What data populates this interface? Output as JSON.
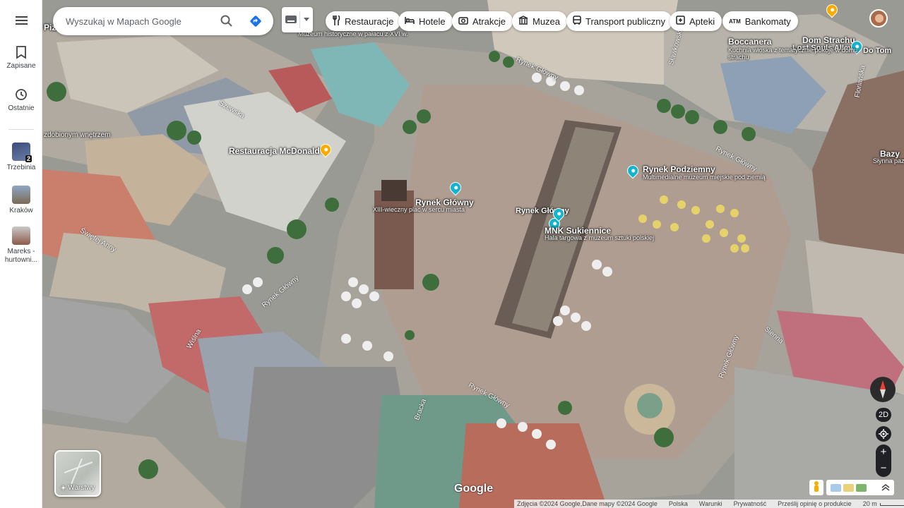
{
  "app": {
    "accent": "#1a73e8"
  },
  "rail": {
    "items": [
      {
        "label": "Zapisane",
        "icon": "bookmark-icon"
      },
      {
        "label": "Ostatnie",
        "icon": "history-icon"
      }
    ],
    "recents": [
      {
        "label": "Trzebinia",
        "badge": "2"
      },
      {
        "label": "Kraków",
        "badge": ""
      },
      {
        "label": "Mareks - hurtowni..."
      }
    ]
  },
  "search": {
    "placeholder": "Wyszukaj w Mapach Google"
  },
  "chips": [
    {
      "label": "Restauracje",
      "icon": "fork-knife-icon"
    },
    {
      "label": "Hotele",
      "icon": "bed-icon"
    },
    {
      "label": "Atrakcje",
      "icon": "camera-icon"
    },
    {
      "label": "Muzea",
      "icon": "museum-icon"
    },
    {
      "label": "Transport publiczny",
      "icon": "bus-icon"
    },
    {
      "label": "Apteki",
      "icon": "pharmacy-icon"
    },
    {
      "label": "Bankomaty",
      "icon": "atm-icon"
    }
  ],
  "map": {
    "pois": [
      {
        "name": "Restauracja McDonald's",
        "color": "#f9ab00"
      },
      {
        "name": "Rynek Główny",
        "sub": "XIII-wieczny plac w sercu miasta",
        "color": "#12b5cb"
      },
      {
        "name": "Rynek Podziemny",
        "sub": "Multimedialne muzeum miejskie pod ziemią",
        "color": "#12b5cb"
      },
      {
        "name": "MNK Sukiennice",
        "sub": "Hala targowa z muzeum sztuki polskiej",
        "color": "#12b5cb"
      },
      {
        "name": "Rynek Główny",
        "color": "#12b5cb"
      },
      {
        "name": "Dom Strachu",
        "sub": "Lost Souls Alley",
        "color": "#12b5cb"
      },
      {
        "name": "Boccanera",
        "sub": "Kuchnia włoska z tematycznie pokoje w domu strachu"
      }
    ],
    "fragments": {
      "top_museum": "Muzeum historyczne w pałacu z XVI w.",
      "left_edge": "zdobionym wnętrzem",
      "pizz": "Pizz",
      "right_baz": "Bazy",
      "right_baz_sub": "Słynna pazylika",
      "domto": "Do Tom"
    },
    "streets": [
      "Rynek Główny",
      "Rynek Główny",
      "Rynek Główny",
      "Rynek Główny",
      "Sienna",
      "Rynek Główny",
      "Bracka",
      "Wiślna",
      "Świętej Anny",
      "Szewska",
      "Sławkowska",
      "Floriańska",
      "Sienna",
      "Rynek Główny"
    ]
  },
  "layers": {
    "label": "Warstwy"
  },
  "controls": {
    "mode_2d": "2D"
  },
  "google": "Google",
  "footer": {
    "imagery": "Zdjęcia ©2024 Google,Dane mapy ©2024 Google",
    "country": "Polska",
    "terms": "Warunki",
    "privacy": "Prywatność",
    "feedback": "Prześlij opinię o produkcie",
    "scale": "20 m"
  }
}
